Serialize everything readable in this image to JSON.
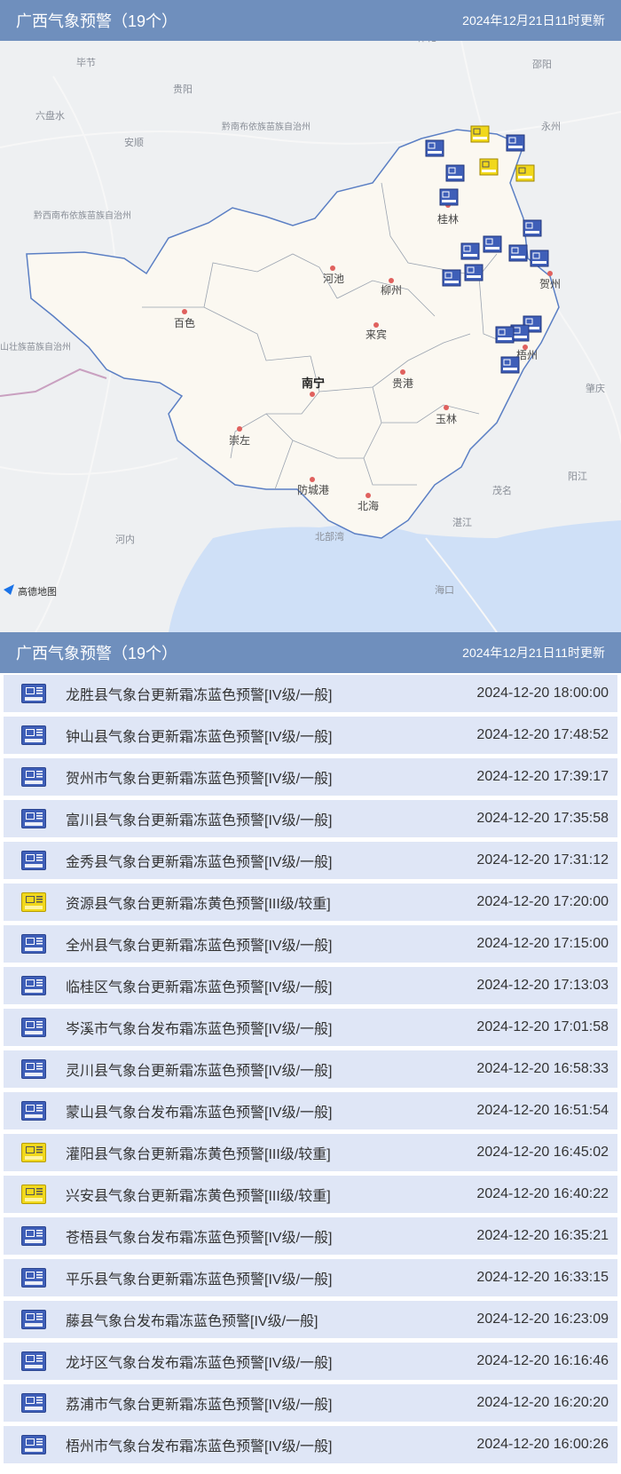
{
  "header": {
    "title": "广西气象预警（19个）",
    "updated": "2024年12月21日11时更新"
  },
  "list_header": {
    "title": "广西气象预警（19个）",
    "updated": "2024年12月21日11时更新"
  },
  "map": {
    "attribution": "高德地图",
    "region_color": "#fbf8f1",
    "outside_color": "#eef0f2",
    "sea_color": "#cfe0f7",
    "cities": [
      {
        "name": "南宁",
        "bold": true
      },
      {
        "name": "桂林"
      },
      {
        "name": "柳州"
      },
      {
        "name": "河池"
      },
      {
        "name": "百色"
      },
      {
        "name": "来宾"
      },
      {
        "name": "贵港"
      },
      {
        "name": "玉林"
      },
      {
        "name": "崇左"
      },
      {
        "name": "防城港"
      },
      {
        "name": "北海"
      },
      {
        "name": "贺州"
      },
      {
        "name": "梧州"
      }
    ],
    "outside_labels": [
      "毕节",
      "贵阳",
      "六盘水",
      "安顺",
      "黔南布依族苗族自治州",
      "黔西南布依族苗族自治州",
      "邵阳",
      "永州",
      "茂名",
      "湛江",
      "阳江",
      "河内",
      "北部湾",
      "海口",
      "山壮族苗族自治州",
      "肇庆",
      "怀化"
    ]
  },
  "alerts": [
    {
      "text": "龙胜县气象台更新霜冻蓝色预警[IV级/一般]",
      "time": "2024-12-20 18:00:00",
      "level": "blue"
    },
    {
      "text": "钟山县气象台更新霜冻蓝色预警[IV级/一般]",
      "time": "2024-12-20 17:48:52",
      "level": "blue"
    },
    {
      "text": "贺州市气象台更新霜冻蓝色预警[IV级/一般]",
      "time": "2024-12-20 17:39:17",
      "level": "blue"
    },
    {
      "text": "富川县气象台更新霜冻蓝色预警[IV级/一般]",
      "time": "2024-12-20 17:35:58",
      "level": "blue"
    },
    {
      "text": "金秀县气象台更新霜冻蓝色预警[IV级/一般]",
      "time": "2024-12-20 17:31:12",
      "level": "blue"
    },
    {
      "text": "资源县气象台更新霜冻黄色预警[III级/较重]",
      "time": "2024-12-20 17:20:00",
      "level": "yellow"
    },
    {
      "text": "全州县气象台更新霜冻蓝色预警[IV级/一般]",
      "time": "2024-12-20 17:15:00",
      "level": "blue"
    },
    {
      "text": "临桂区气象台更新霜冻蓝色预警[IV级/一般]",
      "time": "2024-12-20 17:13:03",
      "level": "blue"
    },
    {
      "text": "岑溪市气象台发布霜冻蓝色预警[IV级/一般]",
      "time": "2024-12-20 17:01:58",
      "level": "blue"
    },
    {
      "text": "灵川县气象台更新霜冻蓝色预警[IV级/一般]",
      "time": "2024-12-20 16:58:33",
      "level": "blue"
    },
    {
      "text": "蒙山县气象台发布霜冻蓝色预警[IV级/一般]",
      "time": "2024-12-20 16:51:54",
      "level": "blue"
    },
    {
      "text": "灌阳县气象台更新霜冻黄色预警[III级/较重]",
      "time": "2024-12-20 16:45:02",
      "level": "yellow"
    },
    {
      "text": "兴安县气象台更新霜冻黄色预警[III级/较重]",
      "time": "2024-12-20 16:40:22",
      "level": "yellow"
    },
    {
      "text": "苍梧县气象台发布霜冻蓝色预警[IV级/一般]",
      "time": "2024-12-20 16:35:21",
      "level": "blue"
    },
    {
      "text": "平乐县气象台更新霜冻蓝色预警[IV级/一般]",
      "time": "2024-12-20 16:33:15",
      "level": "blue"
    },
    {
      "text": "藤县气象台发布霜冻蓝色预警[IV级/一般]",
      "time": "2024-12-20 16:23:09",
      "level": "blue"
    },
    {
      "text": "龙圩区气象台发布霜冻蓝色预警[IV级/一般]",
      "time": "2024-12-20 16:16:46",
      "level": "blue"
    },
    {
      "text": "荔浦市气象台更新霜冻蓝色预警[IV级/一般]",
      "time": "2024-12-20 16:20:20",
      "level": "blue"
    },
    {
      "text": "梧州市气象台发布霜冻蓝色预警[IV级/一般]",
      "time": "2024-12-20 16:00:26",
      "level": "blue"
    }
  ]
}
